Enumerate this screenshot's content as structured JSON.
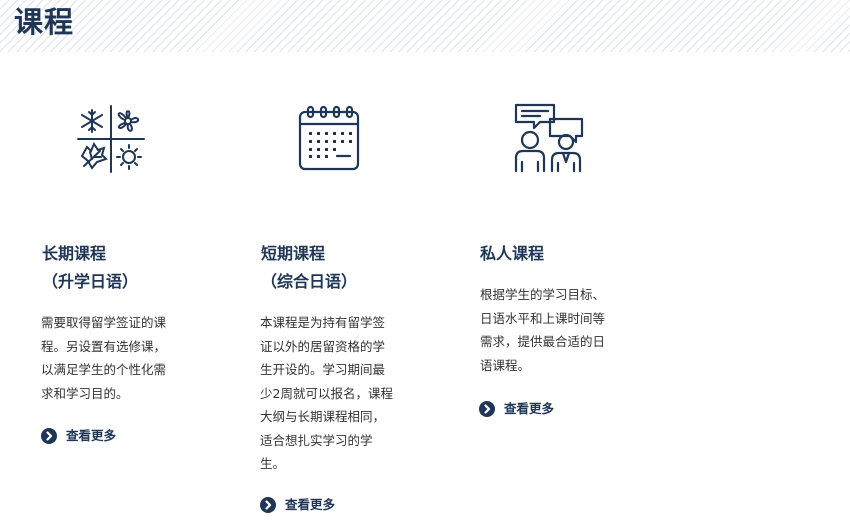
{
  "header": {
    "title": "课程"
  },
  "colors": {
    "primary": "#1f3656",
    "text": "#333333",
    "stripe": "#dfe3ea"
  },
  "courses": [
    {
      "icon": "four-seasons-icon",
      "title_line1": "长期课程",
      "title_line2": "（升学日语）",
      "desc": [
        "需要取得留学签证的课",
        "程。另设置有选修课，",
        "以满足学生的个性化需",
        "求和学习目的。"
      ],
      "more_label": "查看更多"
    },
    {
      "icon": "calendar-icon",
      "title_line1": "短期课程",
      "title_line2": "（综合日语）",
      "desc": [
        "本课程是为持有留学签",
        "证以外的居留资格的学",
        "生开设的。学习期间最",
        "少2周就可以报名，课程",
        "大纲与长期课程相同，",
        "适合想扎实学习的学",
        "生。"
      ],
      "more_label": "查看更多"
    },
    {
      "icon": "private-lesson-icon",
      "title_line1": "私人课程",
      "desc": [
        "根据学生的学习目标、",
        "日语水平和上课时间等",
        "需求，提供最合适的日",
        "语课程。"
      ],
      "more_label": "查看更多"
    }
  ]
}
